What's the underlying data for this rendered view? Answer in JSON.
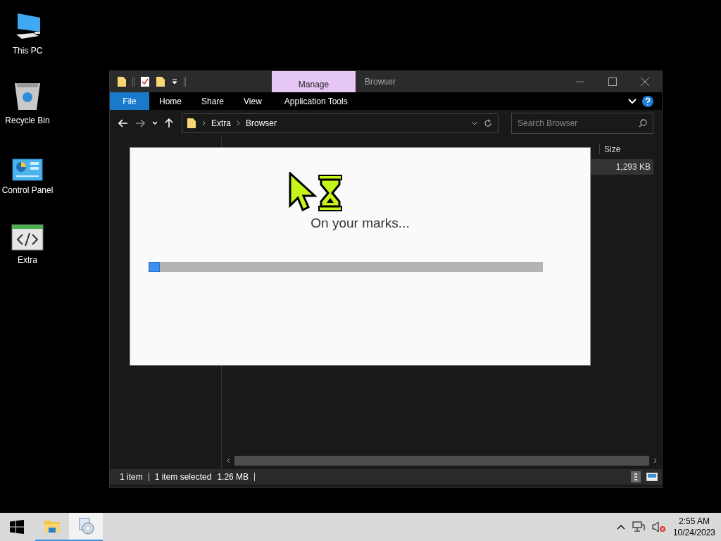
{
  "desktop_icons": [
    {
      "kind": "computer",
      "label": "This PC"
    },
    {
      "kind": "recycle-bin",
      "label": "Recycle Bin"
    },
    {
      "kind": "control-panel",
      "label": "Control Panel"
    },
    {
      "kind": "code-window",
      "label": "Extra"
    }
  ],
  "explorer": {
    "title": "Browser",
    "context_tab": "Manage",
    "ribbon_tabs": [
      {
        "kind": "file",
        "label": "File"
      },
      {
        "kind": "tab",
        "label": "Home"
      },
      {
        "kind": "tab",
        "label": "Share"
      },
      {
        "kind": "tab",
        "label": "View"
      },
      {
        "kind": "context",
        "label": "Application Tools"
      }
    ],
    "path": [
      "Extra",
      "Browser"
    ],
    "search": {
      "placeholder": "Search Browser"
    },
    "columns": [
      "Size"
    ],
    "rows": [
      {
        "size": "1,293 KB"
      }
    ],
    "status_bar": [
      "1 item",
      "1 item selected",
      "1.26 MB"
    ]
  },
  "splash": {
    "message": "On your marks...",
    "level": 0.03
  },
  "taskbar": {
    "apps": [
      {
        "kind": "folder",
        "selected": false
      },
      {
        "kind": "disc",
        "selected": true
      }
    ],
    "time": "2:55 AM",
    "date": "10/24/2023"
  }
}
